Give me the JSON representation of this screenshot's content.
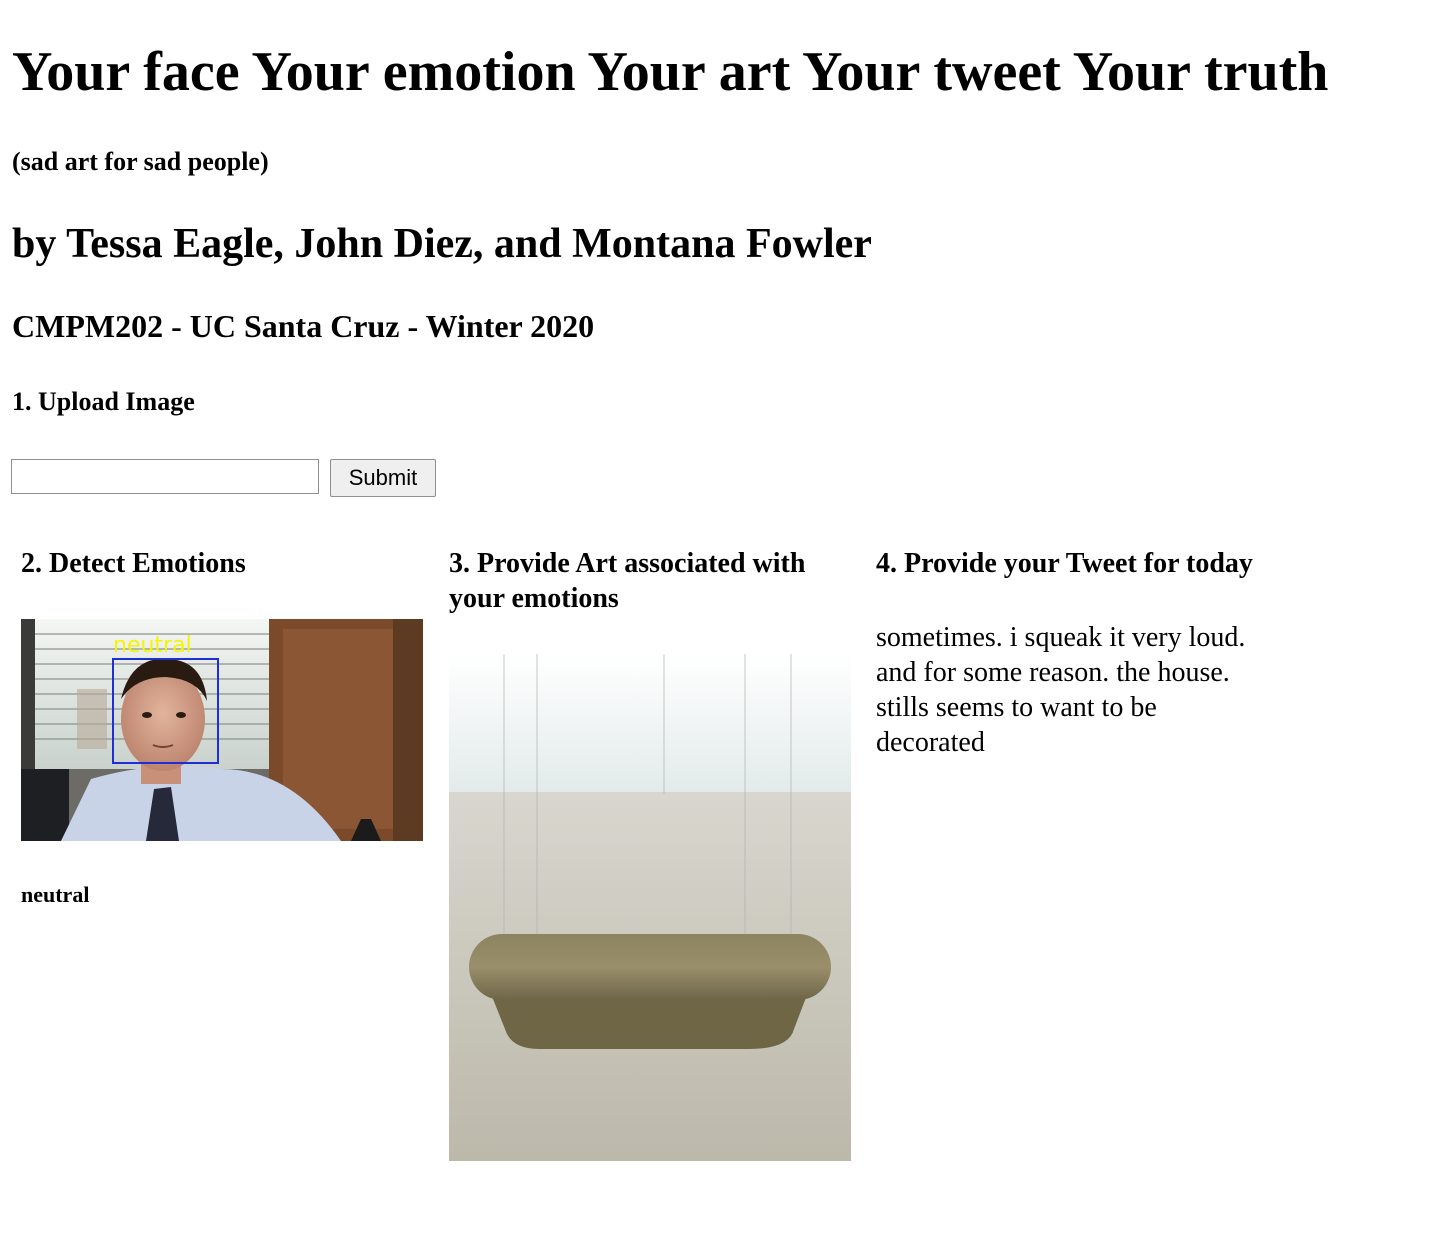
{
  "header": {
    "title": "Your face Your emotion Your art Your tweet Your truth",
    "subtitle": "(sad art for sad people)",
    "authors": "by Tessa Eagle, John Diez, and Montana Fowler",
    "course": "CMPM202 - UC Santa Cruz - Winter 2020"
  },
  "upload": {
    "heading": "1. Upload Image",
    "input_value": "",
    "submit_label": "Submit"
  },
  "detect": {
    "heading": "2. Detect Emotions",
    "image_overlay_label": "neutral",
    "result": "neutral"
  },
  "art": {
    "heading": "3. Provide Art associated with your emotions"
  },
  "tweet": {
    "heading": "4. Provide your Tweet for today",
    "lines": [
      "sometimes. i squeak it very loud.",
      "and for some reason. the house.",
      "stills seems to want to be",
      "decorated"
    ]
  },
  "colors": {
    "face_box": "#1f2fd8",
    "overlay_label": "#f5f500"
  }
}
